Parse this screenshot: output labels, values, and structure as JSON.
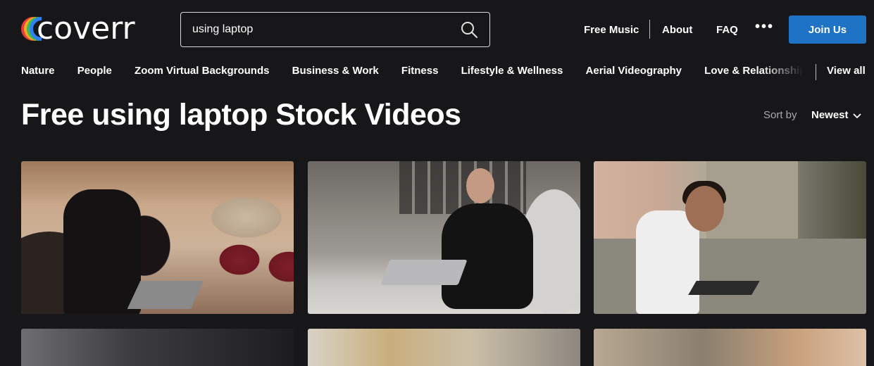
{
  "header": {
    "logo_text": "coverr",
    "search": {
      "value": "using laptop",
      "placeholder": ""
    },
    "nav": {
      "free_music": "Free Music",
      "about": "About",
      "faq": "FAQ",
      "more": "•••"
    },
    "join_label": "Join Us"
  },
  "categories": {
    "items": [
      {
        "label": "Nature"
      },
      {
        "label": "People"
      },
      {
        "label": "Zoom Virtual Backgrounds"
      },
      {
        "label": "Business & Work"
      },
      {
        "label": "Fitness"
      },
      {
        "label": "Lifestyle & Wellness"
      },
      {
        "label": "Aerial Videography"
      },
      {
        "label": "Love & Relationships"
      }
    ],
    "view_all": "View all"
  },
  "main": {
    "title": "Free using laptop Stock Videos",
    "sort_label": "Sort by",
    "sort_value": "Newest"
  },
  "colors": {
    "background": "#171619",
    "accent": "#1f73c4",
    "logo_stripes": [
      "#e63b3b",
      "#f5a623",
      "#3fb950",
      "#2f81f7"
    ]
  },
  "icons": {
    "search": "search-icon",
    "sort": "chevron-down-icon",
    "more": "more-dots-icon"
  }
}
